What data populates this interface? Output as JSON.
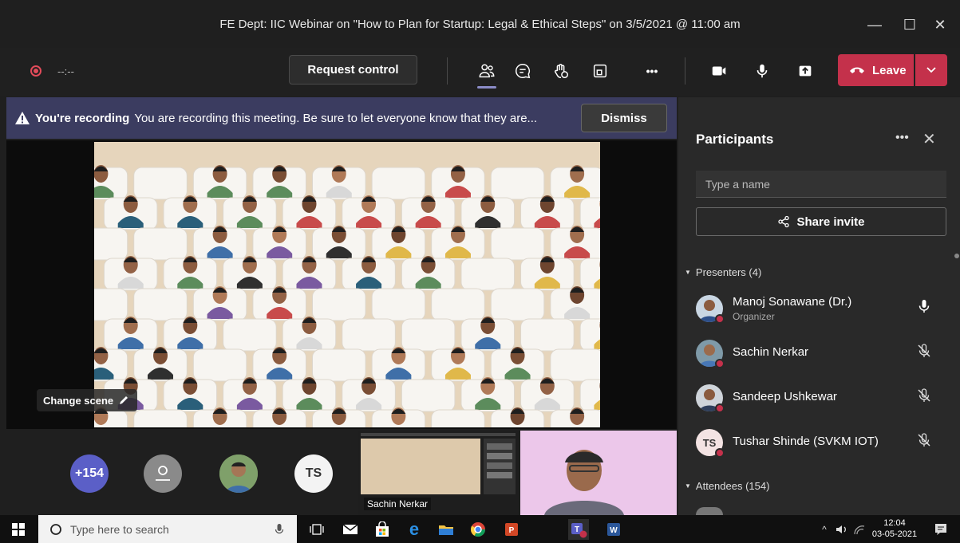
{
  "window": {
    "title": "FE Dept: IIC Webinar on \"How to Plan for Startup: Legal & Ethical Steps\" on 3/5/2021 @ 11:00 am",
    "minimize": "—",
    "maximize": "☐",
    "close": "✕"
  },
  "toolbar": {
    "recording_time": "--:--",
    "request_control_label": "Request control",
    "more_label": "•••",
    "leave_label": "Leave"
  },
  "banner": {
    "heading": "You're recording",
    "message": "You are recording this meeting. Be sure to let everyone know that they are...",
    "dismiss_label": "Dismiss"
  },
  "stage": {
    "change_scene_label": "Change scene"
  },
  "strip": {
    "overflow_count": "+154",
    "ts_initials": "TS",
    "share_presenter_name": "Sachin Nerkar"
  },
  "panel": {
    "title": "Participants",
    "more": "•••",
    "close": "✕",
    "search_placeholder": "Type a name",
    "share_invite_label": "Share invite",
    "presenters_heading": "Presenters (4)",
    "attendees_heading": "Attendees (154)",
    "presenters": [
      {
        "name": "Manoj Sonawane (Dr.)",
        "role": "Organizer",
        "mic": "on"
      },
      {
        "name": "Sachin Nerkar",
        "role": "",
        "mic": "muted"
      },
      {
        "name": "Sandeep Ushkewar",
        "role": "",
        "mic": "muted"
      },
      {
        "name": "Tushar Shinde (SVKM IOT)",
        "initials": "TS",
        "role": "",
        "mic": "muted"
      }
    ]
  },
  "taskbar": {
    "search_placeholder": "Type here to search",
    "time": "12:04",
    "date": "03-05-2021"
  },
  "colors": {
    "accent": "#8b8cc7",
    "leave": "#c4314b",
    "banner": "#3b3c60",
    "overflow_avatar": "#5b5fc7"
  }
}
